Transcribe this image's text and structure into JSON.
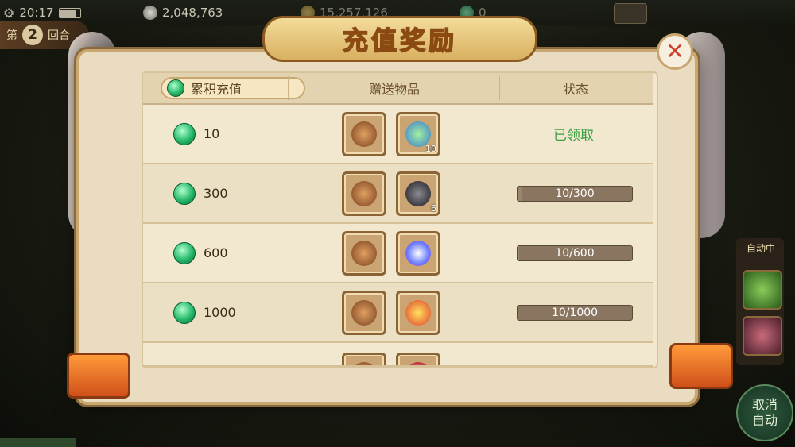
{
  "status_bar": {
    "time": "20:17"
  },
  "currencies": [
    {
      "name": "silver",
      "icon": "silver-coin-icon",
      "value": "2,048,763"
    },
    {
      "name": "gold",
      "icon": "gold-ingot-icon",
      "value": "15,257,126"
    },
    {
      "name": "jade",
      "icon": "jade-coin-icon",
      "value": "0"
    }
  ],
  "round": {
    "prefix": "第",
    "number": "2",
    "suffix": "回合"
  },
  "side_panel": {
    "auto_label": "自动中",
    "cancel_auto": "取消\n自动"
  },
  "modal": {
    "title": "充值奖励",
    "close": "✕",
    "headers": {
      "accumulated": "累积充值",
      "gifts": "赠送物品",
      "status": "状态"
    },
    "rows": [
      {
        "amount": "10",
        "items": [
          {
            "icon": "treasure-bag-icon",
            "count": ""
          },
          {
            "icon": "herb-potion-icon",
            "count": "10"
          }
        ],
        "status_text": "已领取",
        "progress": null
      },
      {
        "amount": "300",
        "items": [
          {
            "icon": "treasure-bag-icon",
            "count": ""
          },
          {
            "icon": "dark-ore-icon",
            "count": "6"
          }
        ],
        "status_text": "10/300",
        "progress": 0.0333
      },
      {
        "amount": "600",
        "items": [
          {
            "icon": "treasure-bag-icon",
            "count": ""
          },
          {
            "icon": "crystal-orb-icon",
            "count": ""
          }
        ],
        "status_text": "10/600",
        "progress": 0.0167
      },
      {
        "amount": "1000",
        "items": [
          {
            "icon": "treasure-bag-icon",
            "count": ""
          },
          {
            "icon": "lucky-bag-icon",
            "count": ""
          }
        ],
        "status_text": "10/1000",
        "progress": 0.01
      },
      {
        "amount": "",
        "items": [
          {
            "icon": "treasure-bag-icon",
            "count": ""
          },
          {
            "icon": "red-bag-icon",
            "count": ""
          }
        ],
        "status_text": "",
        "progress": null
      }
    ]
  },
  "colors": {
    "jade": "#26b86a",
    "claimed": "#3aa040",
    "accent": "#c8a870"
  }
}
